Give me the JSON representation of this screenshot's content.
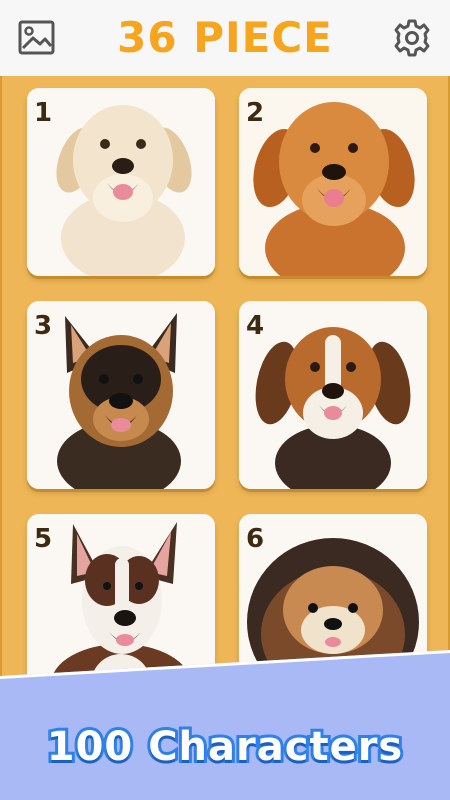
{
  "header": {
    "title": "36 PIECE",
    "gallery_icon": "gallery-image-icon",
    "settings_icon": "gear-icon",
    "title_color": "#f7a41e"
  },
  "board": {
    "background": "#eeb657",
    "cards": [
      {
        "number": "1",
        "subject": "labrador-puppy"
      },
      {
        "number": "2",
        "subject": "golden-retriever-puppy"
      },
      {
        "number": "3",
        "subject": "german-shepherd-puppy"
      },
      {
        "number": "4",
        "subject": "beagle-puppy"
      },
      {
        "number": "5",
        "subject": "bull-terrier-puppy"
      },
      {
        "number": "6",
        "subject": "pomeranian-puppy"
      }
    ]
  },
  "banner": {
    "text": "100 Characters",
    "background": "#a9b9f5",
    "text_stroke": "#2f80e8"
  }
}
